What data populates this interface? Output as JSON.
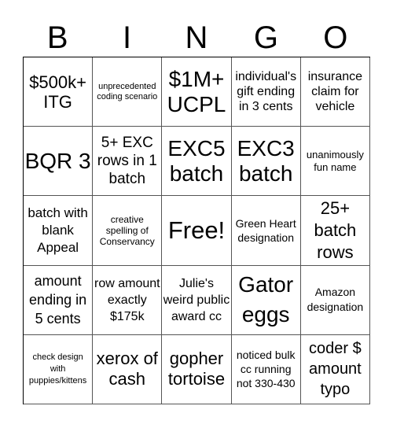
{
  "header": {
    "letters": [
      "B",
      "I",
      "N",
      "G",
      "O"
    ]
  },
  "board": {
    "cells": [
      [
        "$500k+ ITG",
        "unprecedented coding scenario",
        "$1M+ UCPL",
        "individual's gift ending in 3 cents",
        "insurance claim for vehicle"
      ],
      [
        "BQR 3",
        "5+ EXC rows in 1 batch",
        "EXC5 batch",
        "EXC3 batch",
        "unanimously fun name"
      ],
      [
        "batch with blank Appeal",
        "creative spelling of Conservancy",
        "Free!",
        "Green Heart designation",
        "25+ batch rows"
      ],
      [
        "amount ending in 5 cents",
        "row amount exactly $175k",
        "Julie's weird public award cc",
        "Gator eggs",
        "Amazon designation"
      ],
      [
        "check design with puppies/kittens",
        "xerox of cash",
        "gopher tortoise",
        "noticed bulk cc running not 330-430",
        "coder $ amount typo"
      ]
    ]
  }
}
